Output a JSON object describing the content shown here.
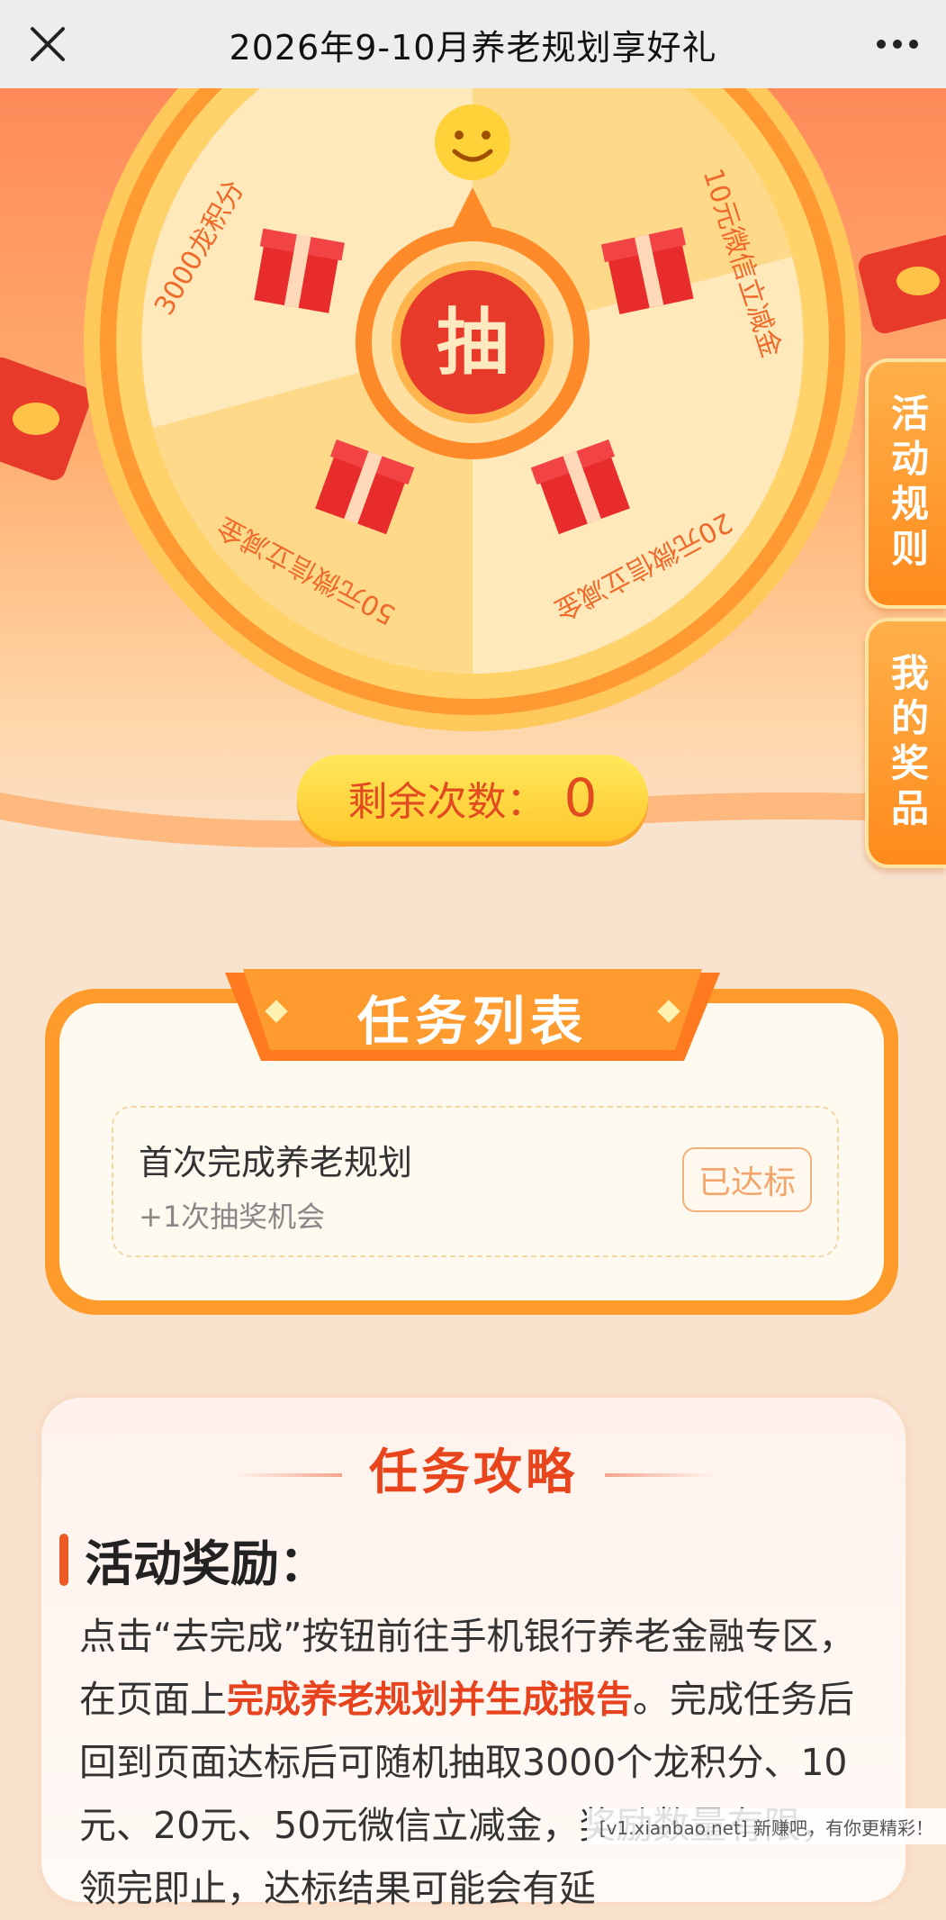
{
  "topbar": {
    "title": "2026年9-10月养老规划享好礼",
    "close_icon": "close-icon",
    "more_icon": "more-icon"
  },
  "wheel": {
    "center_label": "抽",
    "prizes": [
      "3000龙积分",
      "10元微信立减金",
      "20元微信立减金",
      "50元微信立减金"
    ]
  },
  "side_tabs": {
    "rules": "活动规则",
    "prizes": "我的奖品"
  },
  "remaining": {
    "label": "剩余次数：",
    "value": "0"
  },
  "tasks": {
    "title": "任务列表",
    "items": [
      {
        "name": "首次完成养老规划",
        "reward": "+1次抽奖机会",
        "status": "已达标"
      }
    ]
  },
  "guide": {
    "title": "任务攻略",
    "section": "活动奖励：",
    "para_1": "点击“去完成”按钮前往手机银行养老金融专区，在页面上",
    "para_highlight": "完成养老规划并生成报告",
    "para_2": "。完成任务后回到页面达标后可随机抽取3000个龙积分、10元、20元、50元微信立减金，奖励数量有限，领完即止，达标结果可能会有延"
  },
  "watermark": "[v1.xianbao.net] 新赚吧，有你更精彩！",
  "colors": {
    "accent": "#ff8a1c",
    "highlight": "#e8431f",
    "wheel": "#ffe0a0"
  }
}
